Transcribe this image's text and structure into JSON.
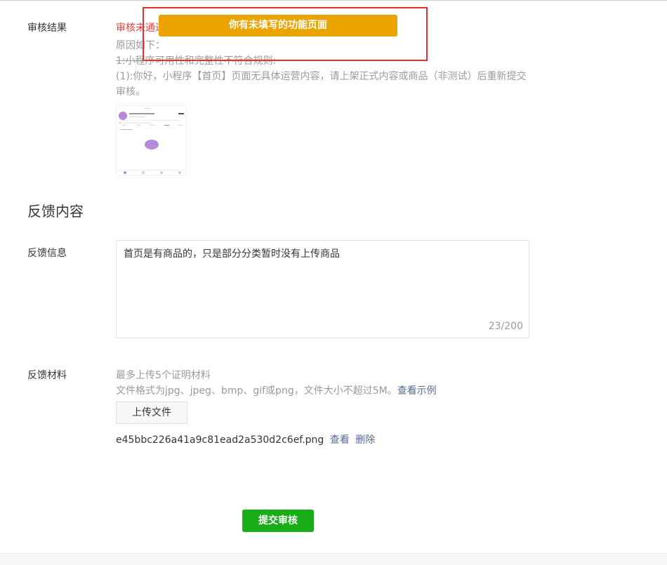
{
  "review": {
    "label": "审核结果",
    "status": "审核未通过",
    "reason_title": "原因如下：",
    "rule_line": "1:小程序可用性和完整性不符合规则:",
    "detail_line": "(1):你好，小程序【首页】页面无具体运营内容，请上架正式内容或商品（非测试）后重新提交审核。"
  },
  "toast": {
    "message": "你有未填写的功能页面",
    "color": "#eba300"
  },
  "feedback": {
    "section_title": "反馈内容",
    "info_label": "反馈信息",
    "info_value": "首页是有商品的，只是部分分类暂时没有上传商品",
    "char_count": "23/200"
  },
  "materials": {
    "label": "反馈材料",
    "hint_max": "最多上传5个证明材料",
    "hint_format": "文件格式为jpg、jpeg、bmp、gif或png，文件大小不超过5M。",
    "example_link": "查看示例",
    "upload_label": "上传文件",
    "file_name": "e45bbc226a41a9c81ead2a530d2c6ef.png",
    "view_link": "查看",
    "delete_link": "删除"
  },
  "actions": {
    "submit_label": "提交审核",
    "submit_color": "#1aad19"
  }
}
